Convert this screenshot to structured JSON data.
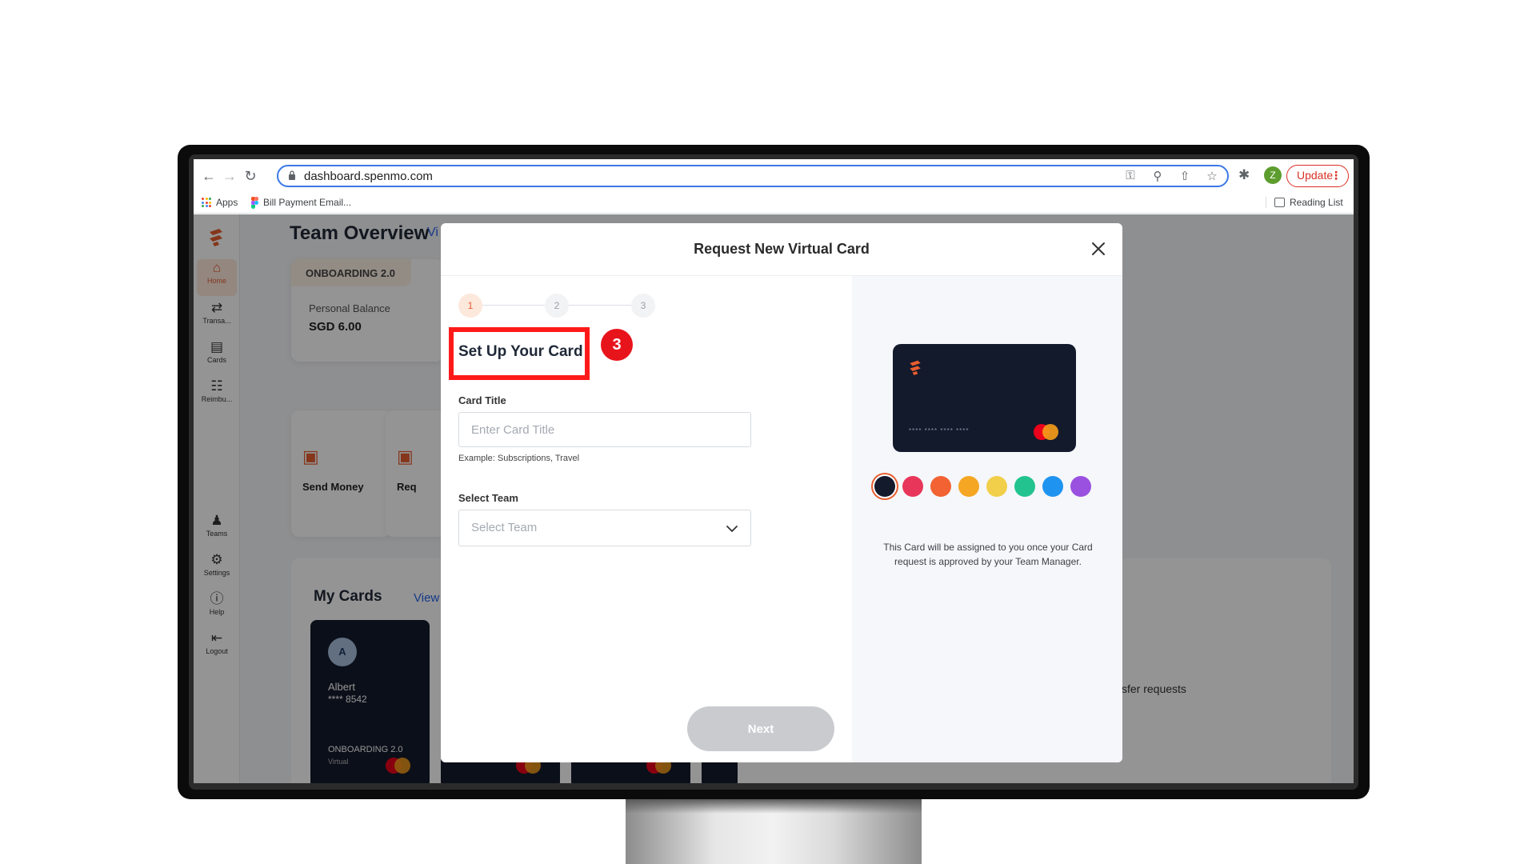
{
  "browser": {
    "url": "dashboard.spenmo.com",
    "update_label": "Update",
    "profile_initial": "Z",
    "bookmarks": [
      {
        "label": "Apps",
        "icon": "apps-grid-icon"
      },
      {
        "label": "Bill Payment Email...",
        "icon": "figma-icon"
      }
    ],
    "reading_list_label": "Reading List"
  },
  "sidebar": {
    "items": [
      {
        "label": "Home",
        "icon": "home-icon"
      },
      {
        "label": "Transa...",
        "icon": "transfer-arrows-icon"
      },
      {
        "label": "Cards",
        "icon": "card-icon"
      },
      {
        "label": "Reimbu...",
        "icon": "receipt-icon"
      },
      {
        "label": "Teams",
        "icon": "users-icon"
      },
      {
        "label": "Settings",
        "icon": "gear-icon"
      },
      {
        "label": "Help",
        "icon": "help-icon"
      },
      {
        "label": "Logout",
        "icon": "logout-icon"
      }
    ]
  },
  "background": {
    "team_title": "Team Overview",
    "team_view_all": "Vi",
    "balance_tag": "ONBOARDING 2.0",
    "balance_label": "Personal Balance",
    "balance_value": "SGD 6.00",
    "actions": [
      "Send Money",
      "Req"
    ],
    "my_cards_title": "My Cards",
    "my_cards_view_all": "View all",
    "card_name": "Albert",
    "card_number": "**** 8542",
    "card_avatar": "A",
    "card_team": "ONBOARDING 2.0",
    "card_type": "Virtual",
    "partial_text": "sfer requests"
  },
  "modal": {
    "title": "Request New Virtual Card",
    "steps": [
      "1",
      "2",
      "3"
    ],
    "active_step": 1,
    "section_title": "Set Up Your Card",
    "annotation_badge": "3",
    "card_title_label": "Card Title",
    "card_title_placeholder": "Enter Card Title",
    "card_title_helper": "Example: Subscriptions, Travel",
    "select_team_label": "Select Team",
    "select_team_placeholder": "Select Team",
    "next_label": "Next",
    "preview_number": "**** **** **** ****",
    "colors": [
      "#131a2c",
      "#e8365a",
      "#f26232",
      "#f5a623",
      "#f2cf4a",
      "#22c38e",
      "#1e94f0",
      "#9b51e0"
    ],
    "selected_color": "#131a2c",
    "note": "This Card will be assigned to you once your Card request is approved by your Team Manager."
  },
  "colors": {
    "accent": "#e65d2f",
    "annotation_red": "#e8141c",
    "link_blue": "#2563eb",
    "card_navy": "#131a2c"
  }
}
